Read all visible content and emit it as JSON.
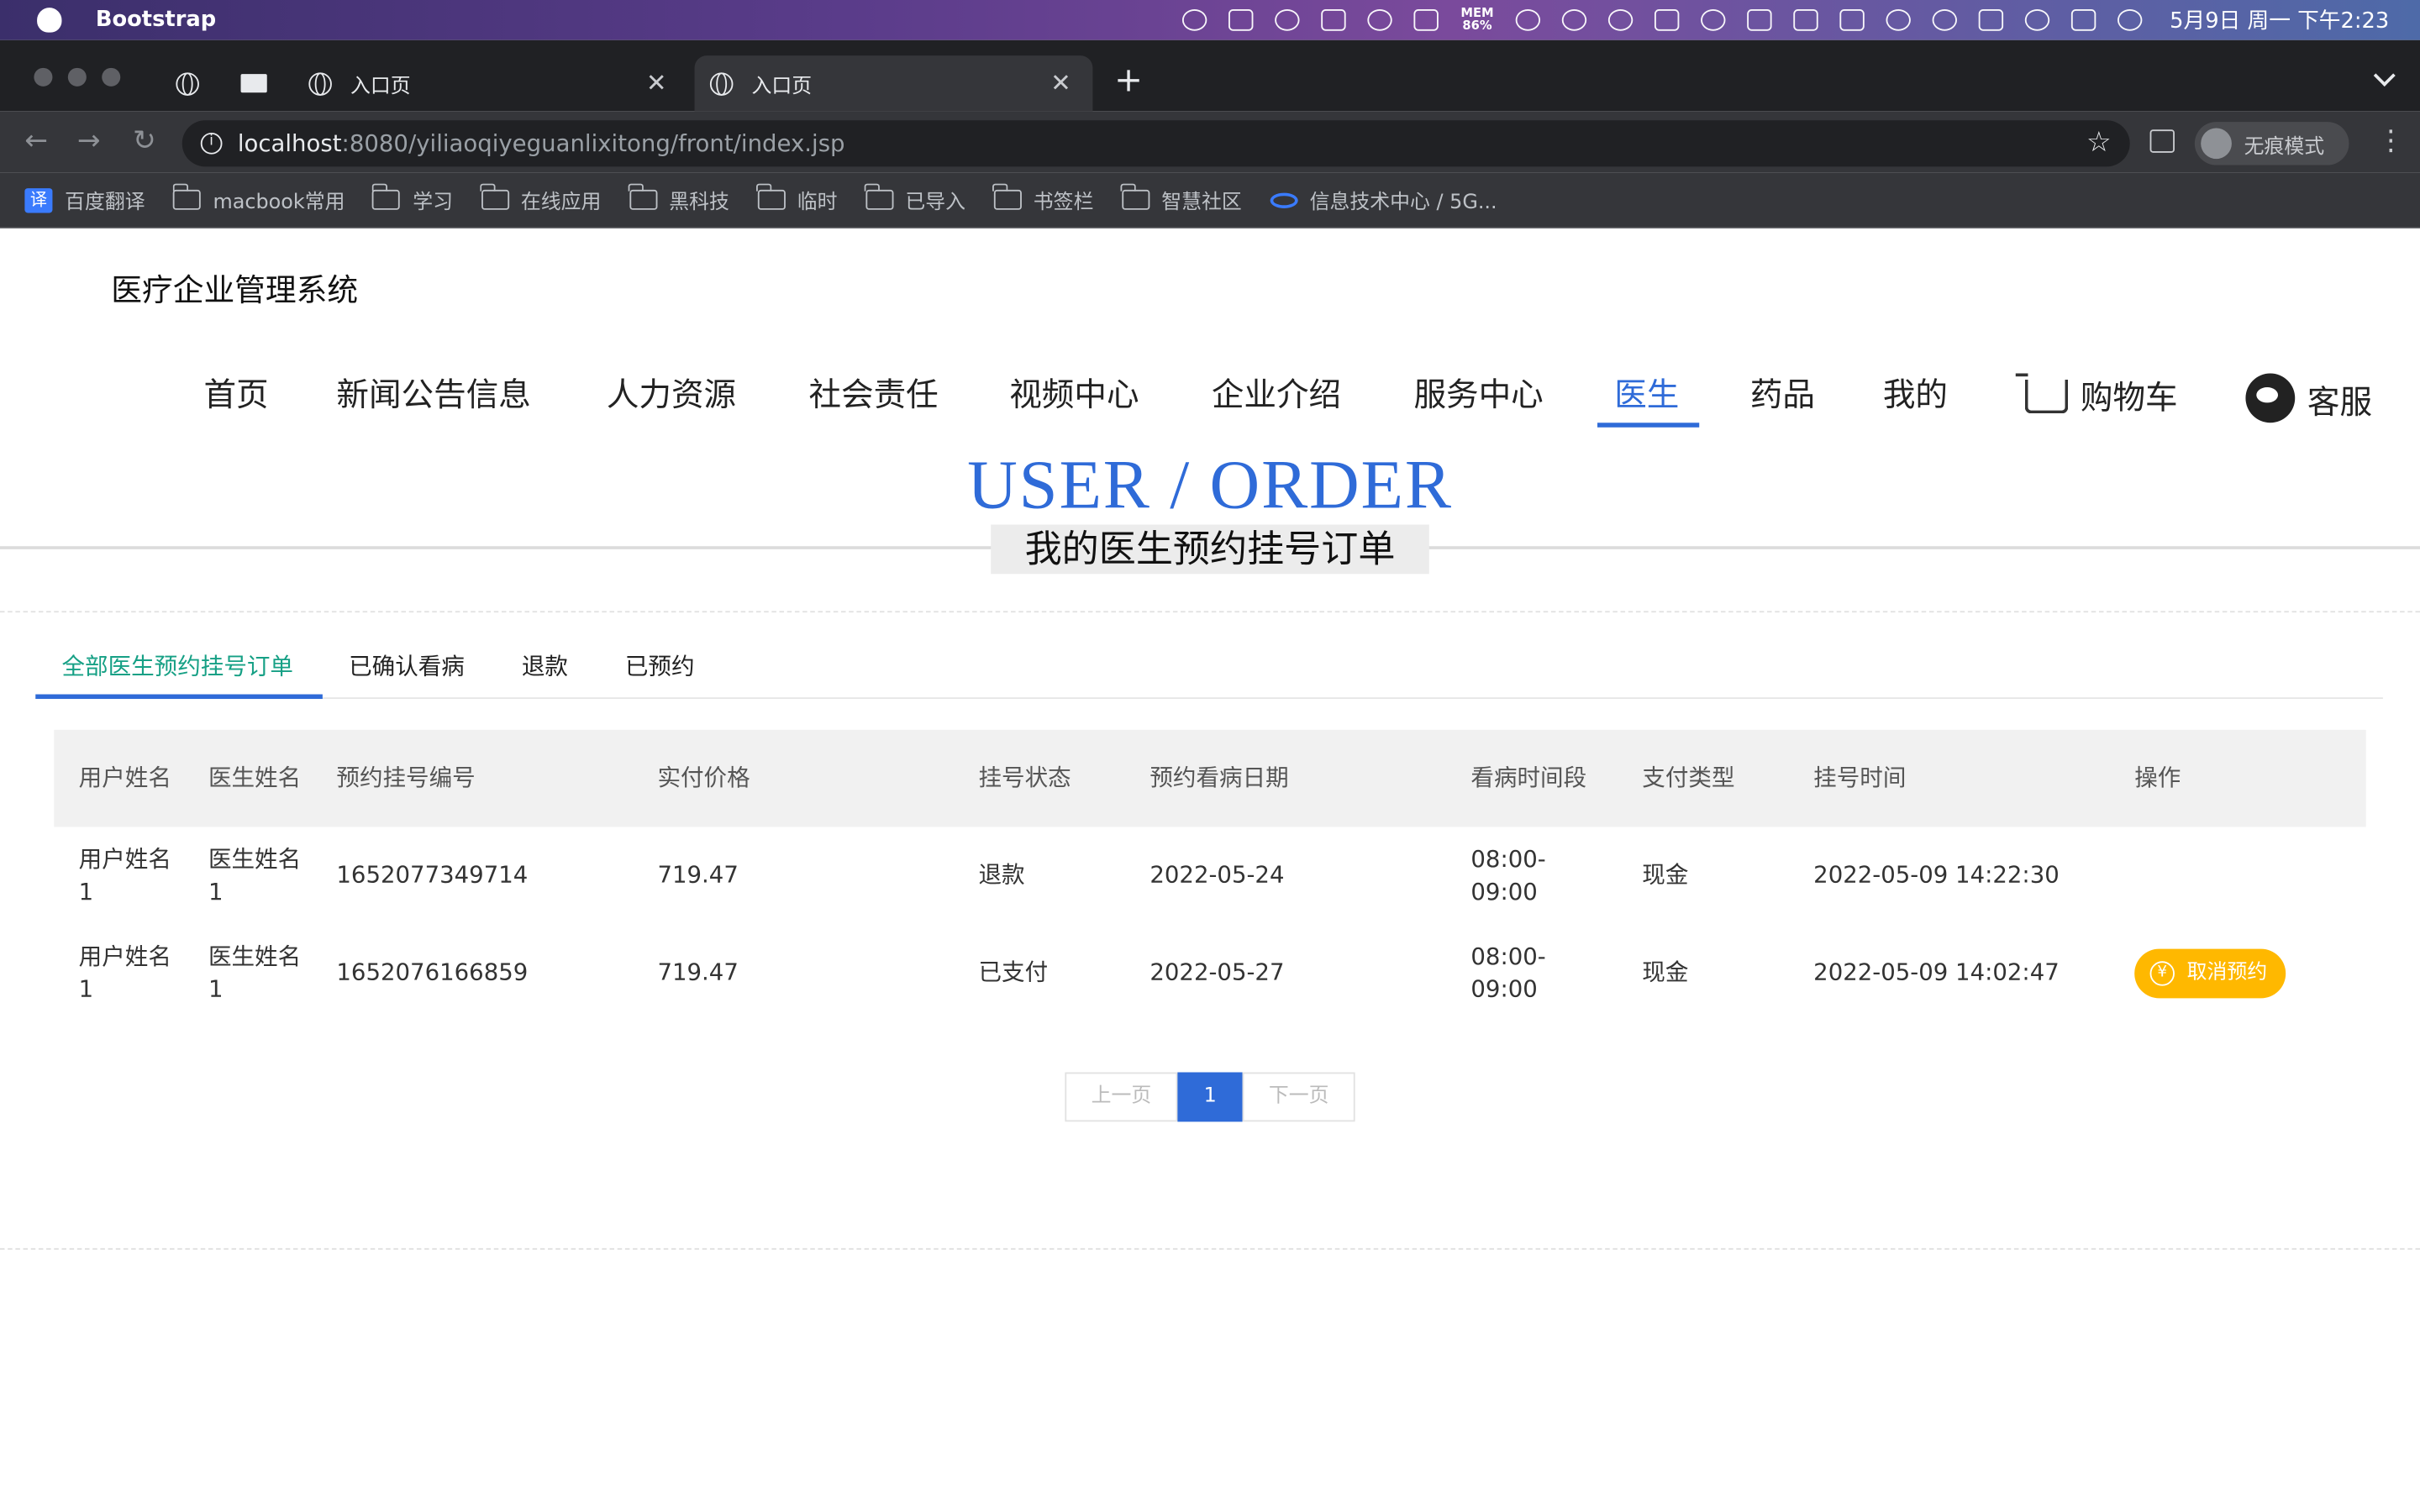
{
  "menubar": {
    "app_name": "Bootstrap",
    "mem_label": "MEM",
    "mem_value": "86%",
    "clock": "5月9日 周一 下午2:23"
  },
  "browser": {
    "tabs": [
      {
        "title": "入口页"
      },
      {
        "title": "入口页"
      }
    ],
    "url_host": "localhost",
    "url_rest": ":8080/yiliaoqiyeguanlixitong/front/index.jsp",
    "incognito_label": "无痕模式",
    "bookmarks": [
      "百度翻译",
      "macbook常用",
      "学习",
      "在线应用",
      "黑科技",
      "临时",
      "已导入",
      "书签栏",
      "智慧社区",
      "信息技术中心 / 5G..."
    ]
  },
  "site": {
    "title": "医疗企业管理系统",
    "nav": [
      "首页",
      "新闻公告信息",
      "人力资源",
      "社会责任",
      "视频中心",
      "企业介绍",
      "服务中心",
      "医生",
      "药品",
      "我的"
    ],
    "cart_label": "购物车",
    "service_label": "客服",
    "active_nav": "医生"
  },
  "hero": {
    "en": "USER / ORDER",
    "cn": "我的医生预约挂号订单"
  },
  "subtabs": [
    "全部医生预约挂号订单",
    "已确认看病",
    "退款",
    "已预约"
  ],
  "table": {
    "headers": [
      "用户姓名",
      "医生姓名",
      "预约挂号编号",
      "实付价格",
      "挂号状态",
      "预约看病日期",
      "看病时间段",
      "支付类型",
      "挂号时间",
      "操作"
    ],
    "rows": [
      {
        "user": "用户姓名1",
        "doctor": "医生姓名1",
        "order_no": "1652077349714",
        "price": "719.47",
        "status": "退款",
        "visit_date": "2022-05-24",
        "slot": "08:00-09:00",
        "pay_type": "现金",
        "created": "2022-05-09 14:22:30",
        "action": ""
      },
      {
        "user": "用户姓名1",
        "doctor": "医生姓名1",
        "order_no": "1652076166859",
        "price": "719.47",
        "status": "已支付",
        "visit_date": "2022-05-27",
        "slot": "08:00-09:00",
        "pay_type": "现金",
        "created": "2022-05-09 14:02:47",
        "action": "取消预约"
      }
    ]
  },
  "pager": {
    "prev": "上一页",
    "current": "1",
    "next": "下一页"
  },
  "colors": {
    "accent": "#2f6bd8",
    "tab_active": "#16a085",
    "cancel_button": "#ffb800"
  }
}
